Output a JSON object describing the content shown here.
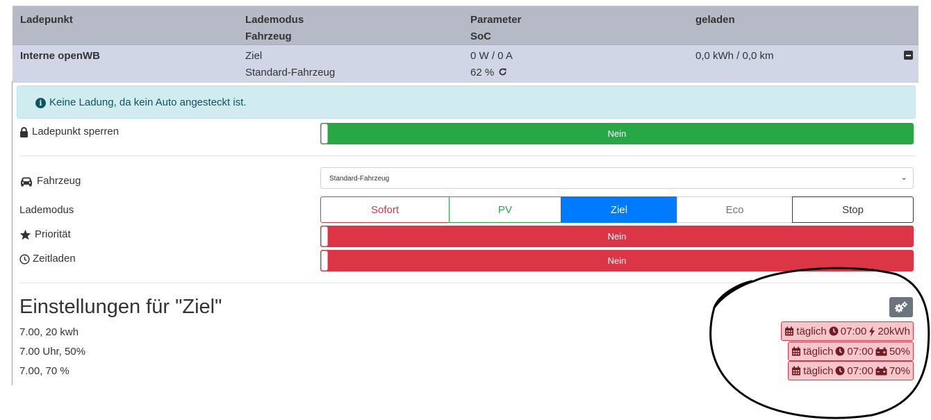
{
  "table_header": {
    "col1": "Ladepunkt",
    "col2_line1": "Lademodus",
    "col2_line2": "Fahrzeug",
    "col3_line1": "Parameter",
    "col3_line2": "SoC",
    "col4": "geladen"
  },
  "chargepoint": {
    "name": "Interne openWB",
    "mode": "Ziel",
    "vehicle": "Standard-Fahrzeug",
    "power": "0 W / 0 A",
    "soc": "62 %",
    "charged": "0,0 kWh / 0,0 km"
  },
  "alert": {
    "text": "Keine Ladung, da kein Auto angesteckt ist."
  },
  "lock": {
    "label": "Ladepunkt sperren",
    "value": "Nein",
    "color": "#28a745"
  },
  "vehicle_select": {
    "label": "Fahrzeug",
    "selected": "Standard-Fahrzeug"
  },
  "charge_mode": {
    "label": "Lademodus",
    "options": [
      "Sofort",
      "PV",
      "Ziel",
      "Eco",
      "Stop"
    ],
    "selected": "Ziel"
  },
  "priority": {
    "label": "Priorität",
    "value": "Nein",
    "color": "#dc3545"
  },
  "time_charging": {
    "label": "Zeitladen",
    "value": "Nein",
    "color": "#dc3545"
  },
  "settings": {
    "title": "Einstellungen für \"Ziel\"",
    "plans": [
      {
        "name": "7.00, 20 kwh",
        "freq": "täglich",
        "time": "07:00",
        "goal_icon": "bolt-icon",
        "goal": "20kWh"
      },
      {
        "name": "7.00 Uhr, 50%",
        "freq": "täglich",
        "time": "07:00",
        "goal_icon": "car-battery-icon",
        "goal": "50%"
      },
      {
        "name": "7.00, 70 %",
        "freq": "täglich",
        "time": "07:00",
        "goal_icon": "car-battery-icon",
        "goal": "70%"
      }
    ]
  },
  "colors": {
    "header_bg": "#b5bac6",
    "row_bg": "#d0d6e6",
    "alert_bg": "#d1ecf1",
    "selected_mode": "#007bff",
    "badge_bg": "#f5c6cb"
  }
}
